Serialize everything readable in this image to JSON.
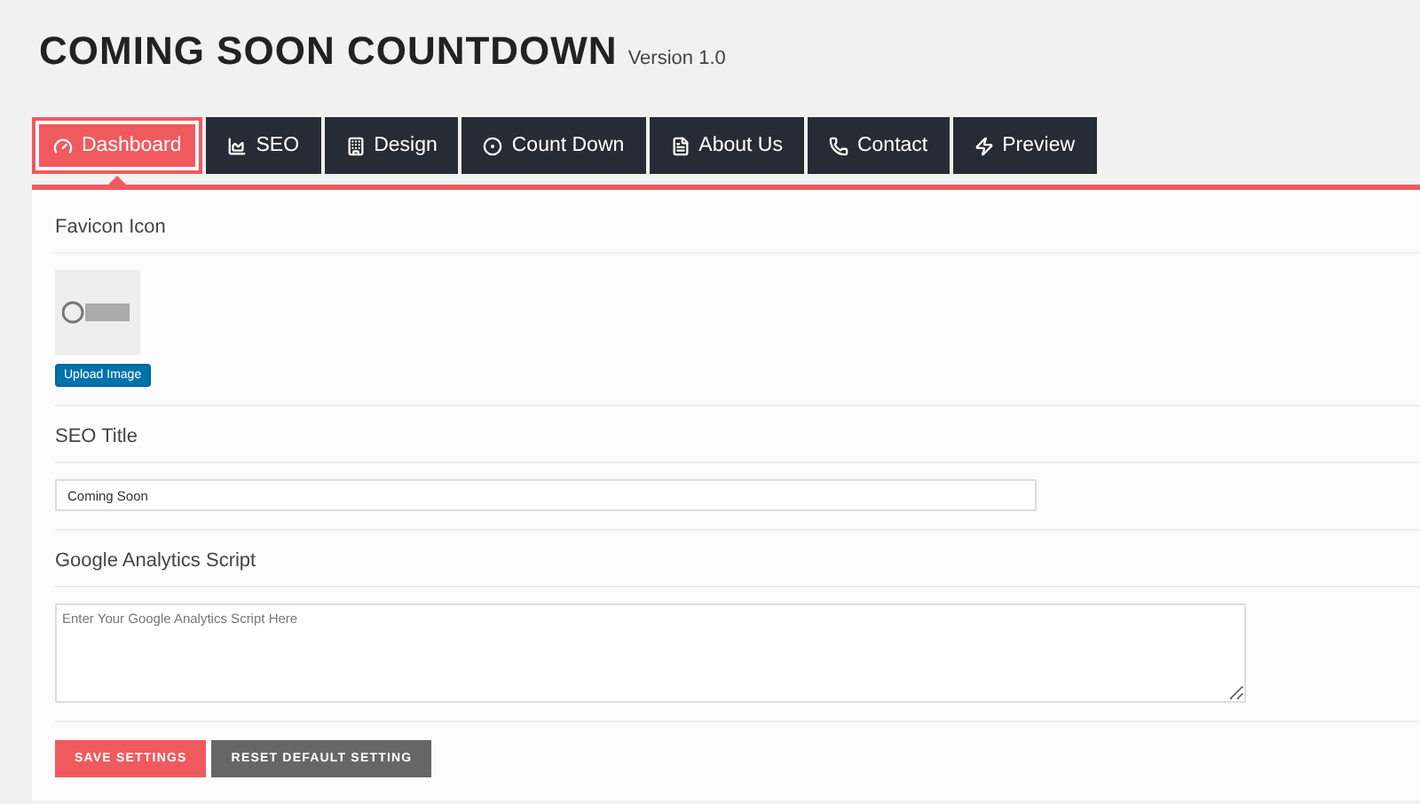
{
  "header": {
    "title": "COMING SOON COUNTDOWN",
    "version": "Version 1.0"
  },
  "tabs": [
    {
      "label": "Dashboard",
      "selected": true
    },
    {
      "label": "SEO",
      "selected": false
    },
    {
      "label": "Design",
      "selected": false
    },
    {
      "label": "Count Down",
      "selected": false
    },
    {
      "label": "About Us",
      "selected": false
    },
    {
      "label": "Contact",
      "selected": false
    },
    {
      "label": "Preview",
      "selected": false
    }
  ],
  "favicon": {
    "label": "Favicon Icon",
    "upload_button": "Upload Image"
  },
  "seo_title": {
    "label": "SEO Title",
    "value": "Coming Soon"
  },
  "analytics": {
    "label": "Google Analytics Script",
    "placeholder": "Enter Your Google Analytics Script Here"
  },
  "buttons": {
    "save": "SAVE SETTINGS",
    "reset": "RESET DEFAULT SETTING"
  }
}
